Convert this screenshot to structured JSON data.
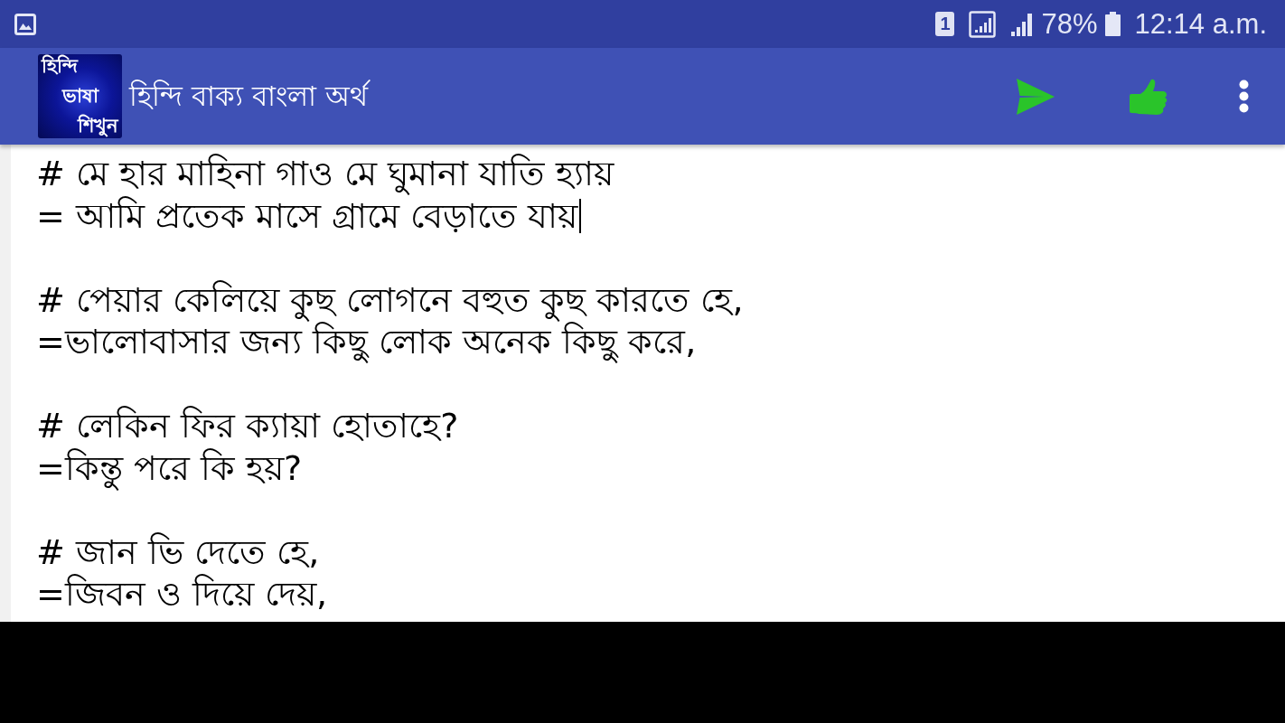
{
  "status_bar": {
    "sim_slot": "1",
    "battery": "78%",
    "time": "12:14 a.m."
  },
  "app_bar": {
    "logo_lines": [
      "হিন্দি",
      "ভাষা",
      "শিখুন"
    ],
    "title": "হিন্দি বাক্য বাংলা অর্থ"
  },
  "editor": {
    "entries": [
      {
        "hindi": "# মে হার মাহিনা গাও মে ঘুমানা যাতি হ্যায়",
        "bangla": "= আমি প্রতেক মাসে গ্রামে বেড়াতে যায়",
        "cursor": true
      },
      {
        "hindi": "# পেয়ার কেলিয়ে কুছ লোগনে বহুত কুছ কারতে হে,",
        "bangla": "=ভালোবাসার জন্য কিছু লোক অনেক কিছু করে,",
        "cursor": false
      },
      {
        "hindi": "# লেকিন ফির ক্যায়া হোতাহে?",
        "bangla": "=কিন্তু পরে কি হয়?",
        "cursor": false
      },
      {
        "hindi": "# জান ভি দেতে হে,",
        "bangla": "=জিবন ও দিয়ে দেয়,",
        "cursor": false
      }
    ]
  }
}
